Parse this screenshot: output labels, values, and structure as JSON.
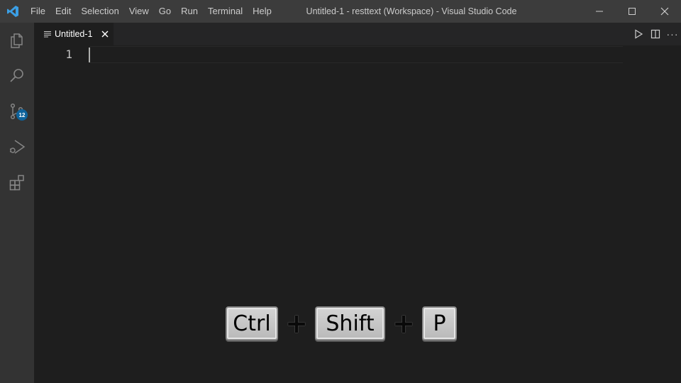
{
  "titlebar": {
    "menu": [
      "File",
      "Edit",
      "Selection",
      "View",
      "Go",
      "Run",
      "Terminal",
      "Help"
    ],
    "title": "Untitled-1 - resttext (Workspace) - Visual Studio Code",
    "logo_icon": "vscode-logo-icon",
    "controls": [
      "minimize-icon",
      "maximize-icon",
      "close-icon"
    ]
  },
  "activitybar": {
    "items": [
      "files-icon",
      "search-icon",
      "source-control-icon",
      "run-debug-icon",
      "extensions-icon"
    ],
    "source_control_badge": "12"
  },
  "tabs": [
    {
      "label": "Untitled-1",
      "icon": "lines-icon",
      "active": true
    }
  ],
  "editor_actions": [
    "run-icon",
    "split-editor-icon",
    "more-actions-icon"
  ],
  "editor": {
    "line_numbers": [
      "1"
    ]
  },
  "keyboard_overlay": {
    "keys": [
      "Ctrl",
      "Shift",
      "P"
    ],
    "separator": "+"
  },
  "colors": {
    "titlebar": "#3c3c3c",
    "activitybar": "#333333",
    "editor_bg": "#1e1e1e",
    "tabs_bg": "#252526",
    "badge": "#0e639c",
    "logo": "#3b9fe5"
  }
}
